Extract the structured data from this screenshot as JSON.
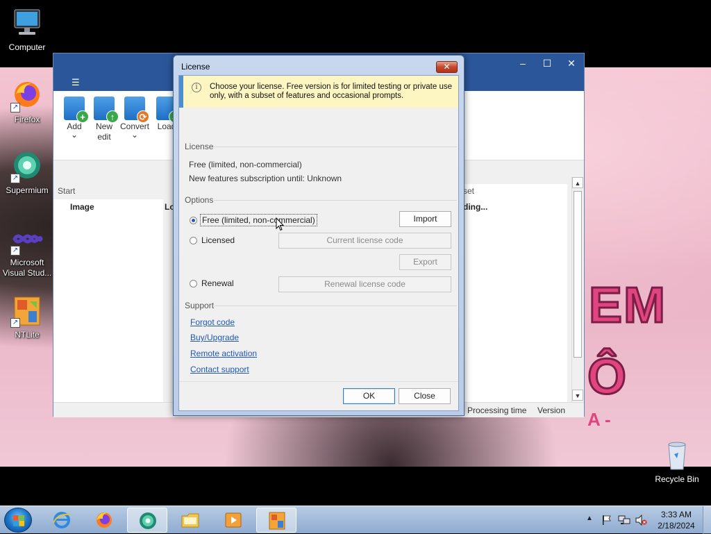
{
  "desktop": {
    "icons": [
      {
        "label": "Computer"
      },
      {
        "label": "Firefox"
      },
      {
        "label": "Supermium"
      },
      {
        "label": "Microsoft Visual Stud..."
      },
      {
        "label": "NTLite"
      },
      {
        "label": "Recycle Bin"
      }
    ],
    "wallpaper_text": [
      "EM",
      "Ô",
      "A -"
    ]
  },
  "app": {
    "menu_icon": "☰",
    "controls": {
      "minimize": "–",
      "maximize": "☐",
      "close": "✕"
    },
    "ribbon": [
      {
        "label": "Add",
        "sub": "⌄",
        "icon": "add-icon"
      },
      {
        "label": "New\nedit",
        "icon": "new-edit-icon"
      },
      {
        "label": "Convert",
        "sub": "⌄",
        "icon": "convert-icon"
      },
      {
        "label": "Load",
        "icon": "load-icon"
      }
    ],
    "start_label": "Start",
    "col_image": "Image",
    "col_lo": "Lo",
    "col_set": "set",
    "col_loading": "ding...",
    "status": {
      "processing_time": "Processing time",
      "version": "Version"
    }
  },
  "dialog": {
    "title": "License",
    "close_glyph": "✕",
    "info": "Choose your license. Free version is for limited testing or private use only, with a subset of features and occasional prompts.",
    "license_section": "License",
    "license_type": "Free (limited, non-commercial)",
    "subscription": "New features subscription until: Unknown",
    "options_section": "Options",
    "options": [
      {
        "label": "Free (limited, non-commercial)",
        "checked": true
      },
      {
        "label": "Licensed",
        "checked": false
      },
      {
        "label": "Renewal",
        "checked": false
      }
    ],
    "buttons": {
      "import": "Import",
      "current_license_code": "Current license code",
      "export": "Export",
      "renewal_license_code": "Renewal license code",
      "ok": "OK",
      "close": "Close"
    },
    "support_section": "Support",
    "links": [
      "Forgot code",
      "Buy/Upgrade",
      "Remote activation",
      "Contact support"
    ]
  },
  "taskbar": {
    "apps": [
      "internet-explorer-icon",
      "firefox-icon",
      "supermium-icon",
      "file-explorer-icon",
      "media-player-icon",
      "ntlite-icon"
    ],
    "clock": {
      "time": "3:33 AM",
      "date": "2/18/2024"
    },
    "tray_arrow": "▲"
  },
  "colors": {
    "titlebar": "#2b579a",
    "link": "#1f58b8",
    "info_bg": "#fdf6c2",
    "info_accent": "#4c8ed0"
  }
}
